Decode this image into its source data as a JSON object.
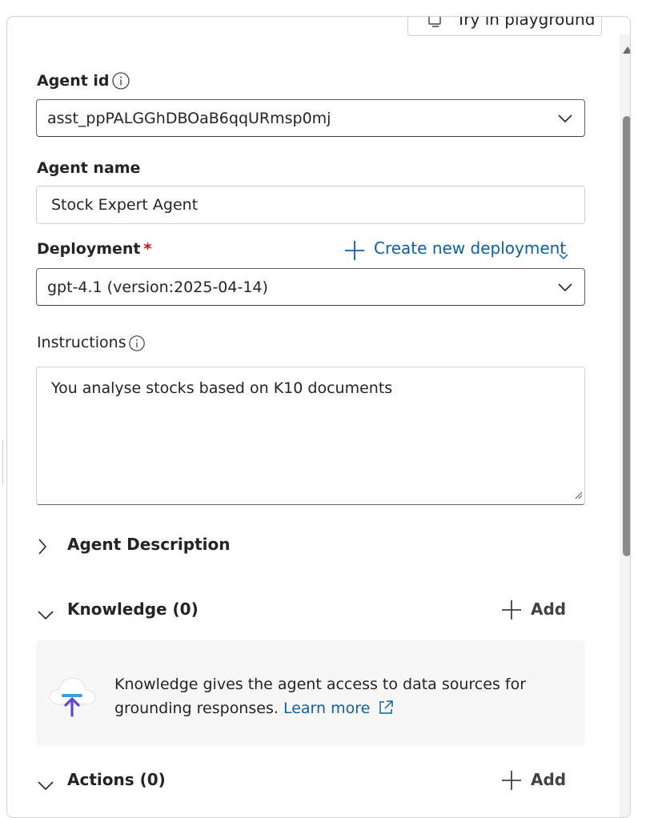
{
  "header": {
    "playground_button": "Try in playground"
  },
  "agent_id": {
    "label": "Agent id",
    "value": "asst_ppPALGGhDBOaB6qqURmsp0mj"
  },
  "agent_name": {
    "label": "Agent name",
    "value": "Stock Expert Agent"
  },
  "deployment": {
    "label": "Deployment",
    "required_marker": "*",
    "value": "gpt-4.1 (version:2025-04-14)",
    "create_link": "Create new deployment"
  },
  "instructions": {
    "label": "Instructions",
    "value": "You analyse stocks based on K10 documents"
  },
  "sections": {
    "agent_description": {
      "title": "Agent Description",
      "expanded": false
    },
    "knowledge": {
      "title": "Knowledge (0)",
      "expanded": true,
      "add_label": "Add",
      "message": "Knowledge gives the agent access to data sources for grounding responses.",
      "learn_more": "Learn more"
    },
    "actions": {
      "title": "Actions (0)",
      "expanded": true,
      "add_label": "Add"
    }
  },
  "colors": {
    "link": "#115ea3",
    "required": "#c50f1f",
    "border": "#d1d1d1",
    "text": "#242424"
  }
}
